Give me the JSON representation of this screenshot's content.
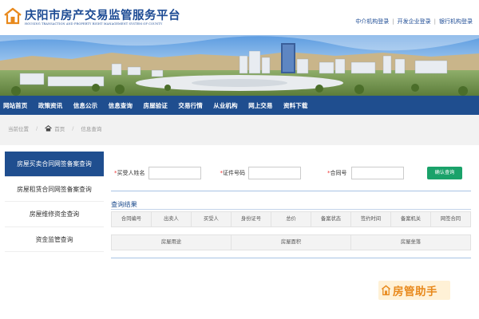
{
  "header": {
    "title": "庆阳市房产交易监管服务平台",
    "subtitle": "HOUSING TRANSACTION AND PROPERTY RIGHT MANAGEMENT SYSTEM OF COUNTY",
    "top_links": [
      "中介机构登录",
      "开发企业登录",
      "银行机构登录"
    ]
  },
  "nav": {
    "items": [
      "网站首页",
      "政策资讯",
      "信息公示",
      "信息查询",
      "房屋验证",
      "交易行情",
      "从业机构",
      "网上交易",
      "资料下载"
    ]
  },
  "breadcrumb": {
    "prefix": "当前位置",
    "home": "首页",
    "current": "信息查询"
  },
  "sidebar": {
    "items": [
      "房屋买卖合同网签备案查询",
      "房屋租赁合同网签备案查询",
      "房屋维修资金查询",
      "资金监管查询"
    ],
    "active_index": 0
  },
  "form": {
    "buyer_label": "买受人姓名",
    "cert_label": "证件号码",
    "contract_label": "合同号",
    "required_mark": "*",
    "buyer_value": "",
    "cert_value": "",
    "contract_value": "",
    "confirm_label": "确认查询"
  },
  "results": {
    "title": "查询结果",
    "columns": [
      "合同编号",
      "出卖人",
      "买受人",
      "身份证号",
      "总价",
      "备案状态",
      "签约时间",
      "备案机关",
      "网签合同"
    ],
    "columns2": [
      "房屋用途",
      "房屋面积",
      "房屋坐落"
    ]
  },
  "watermark": {
    "text": "房管助手"
  },
  "colors": {
    "brand_blue": "#1f4e8f",
    "button_green": "#1aa26a",
    "logo_orange": "#e8891c"
  }
}
